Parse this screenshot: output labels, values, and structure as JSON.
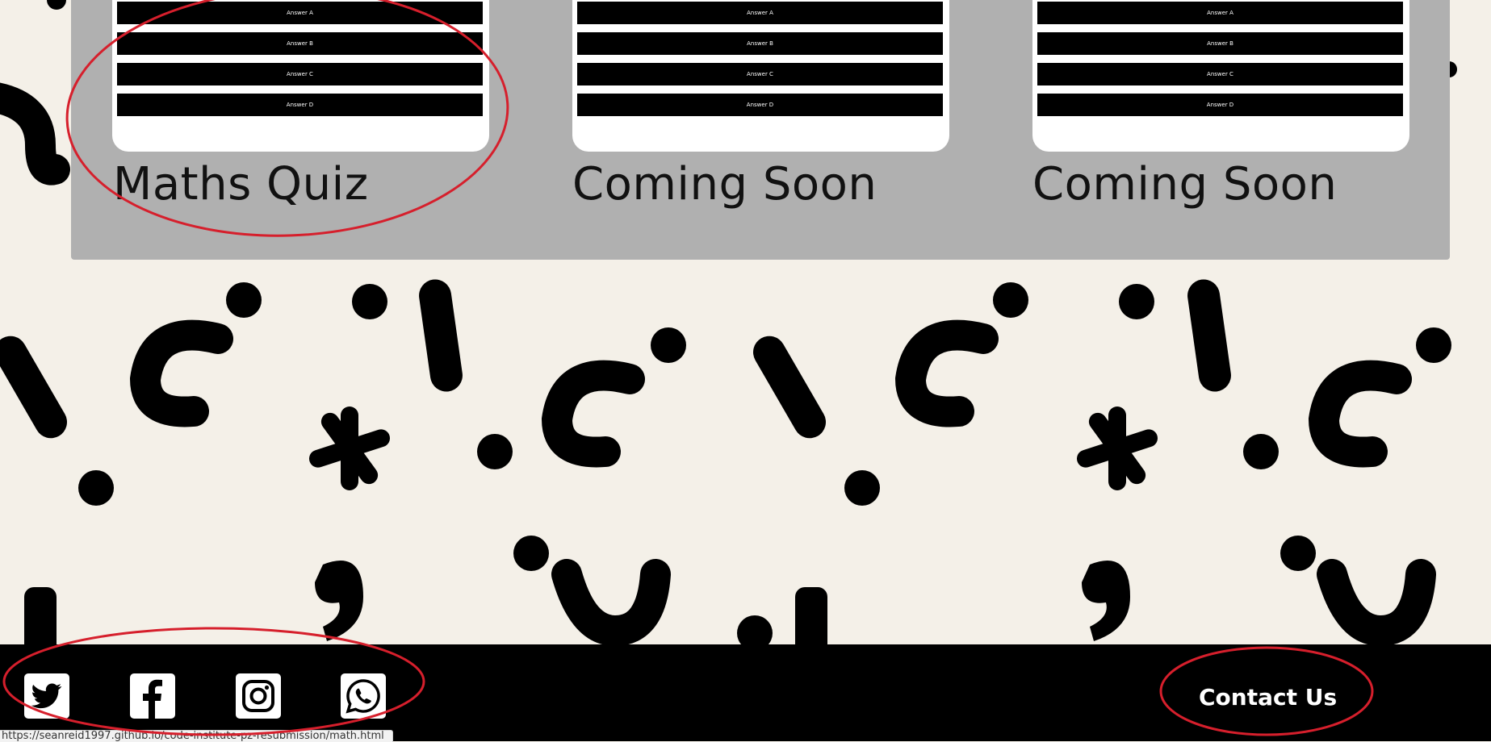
{
  "quiz_cards": [
    {
      "title": "Maths Quiz",
      "answers": [
        "Answer A",
        "Answer B",
        "Answer C",
        "Answer D"
      ]
    },
    {
      "title": "Coming Soon",
      "answers": [
        "Answer A",
        "Answer B",
        "Answer C",
        "Answer D"
      ]
    },
    {
      "title": "Coming Soon",
      "answers": [
        "Answer A",
        "Answer B",
        "Answer C",
        "Answer D"
      ]
    }
  ],
  "footer": {
    "social_icons": [
      "twitter-icon",
      "facebook-icon",
      "instagram-icon",
      "whatsapp-icon"
    ],
    "contact_label": "Contact Us"
  },
  "status_bar": {
    "url": "https://seanreid1997.github.io/code-institute-pz-resubmission/math.html"
  },
  "colors": {
    "page_background": "#f4f0e8",
    "panel": "#b0b0b0",
    "card": "#ffffff",
    "answer_button": "#000000",
    "footer": "#000000",
    "annotation": "#d61f2c"
  }
}
